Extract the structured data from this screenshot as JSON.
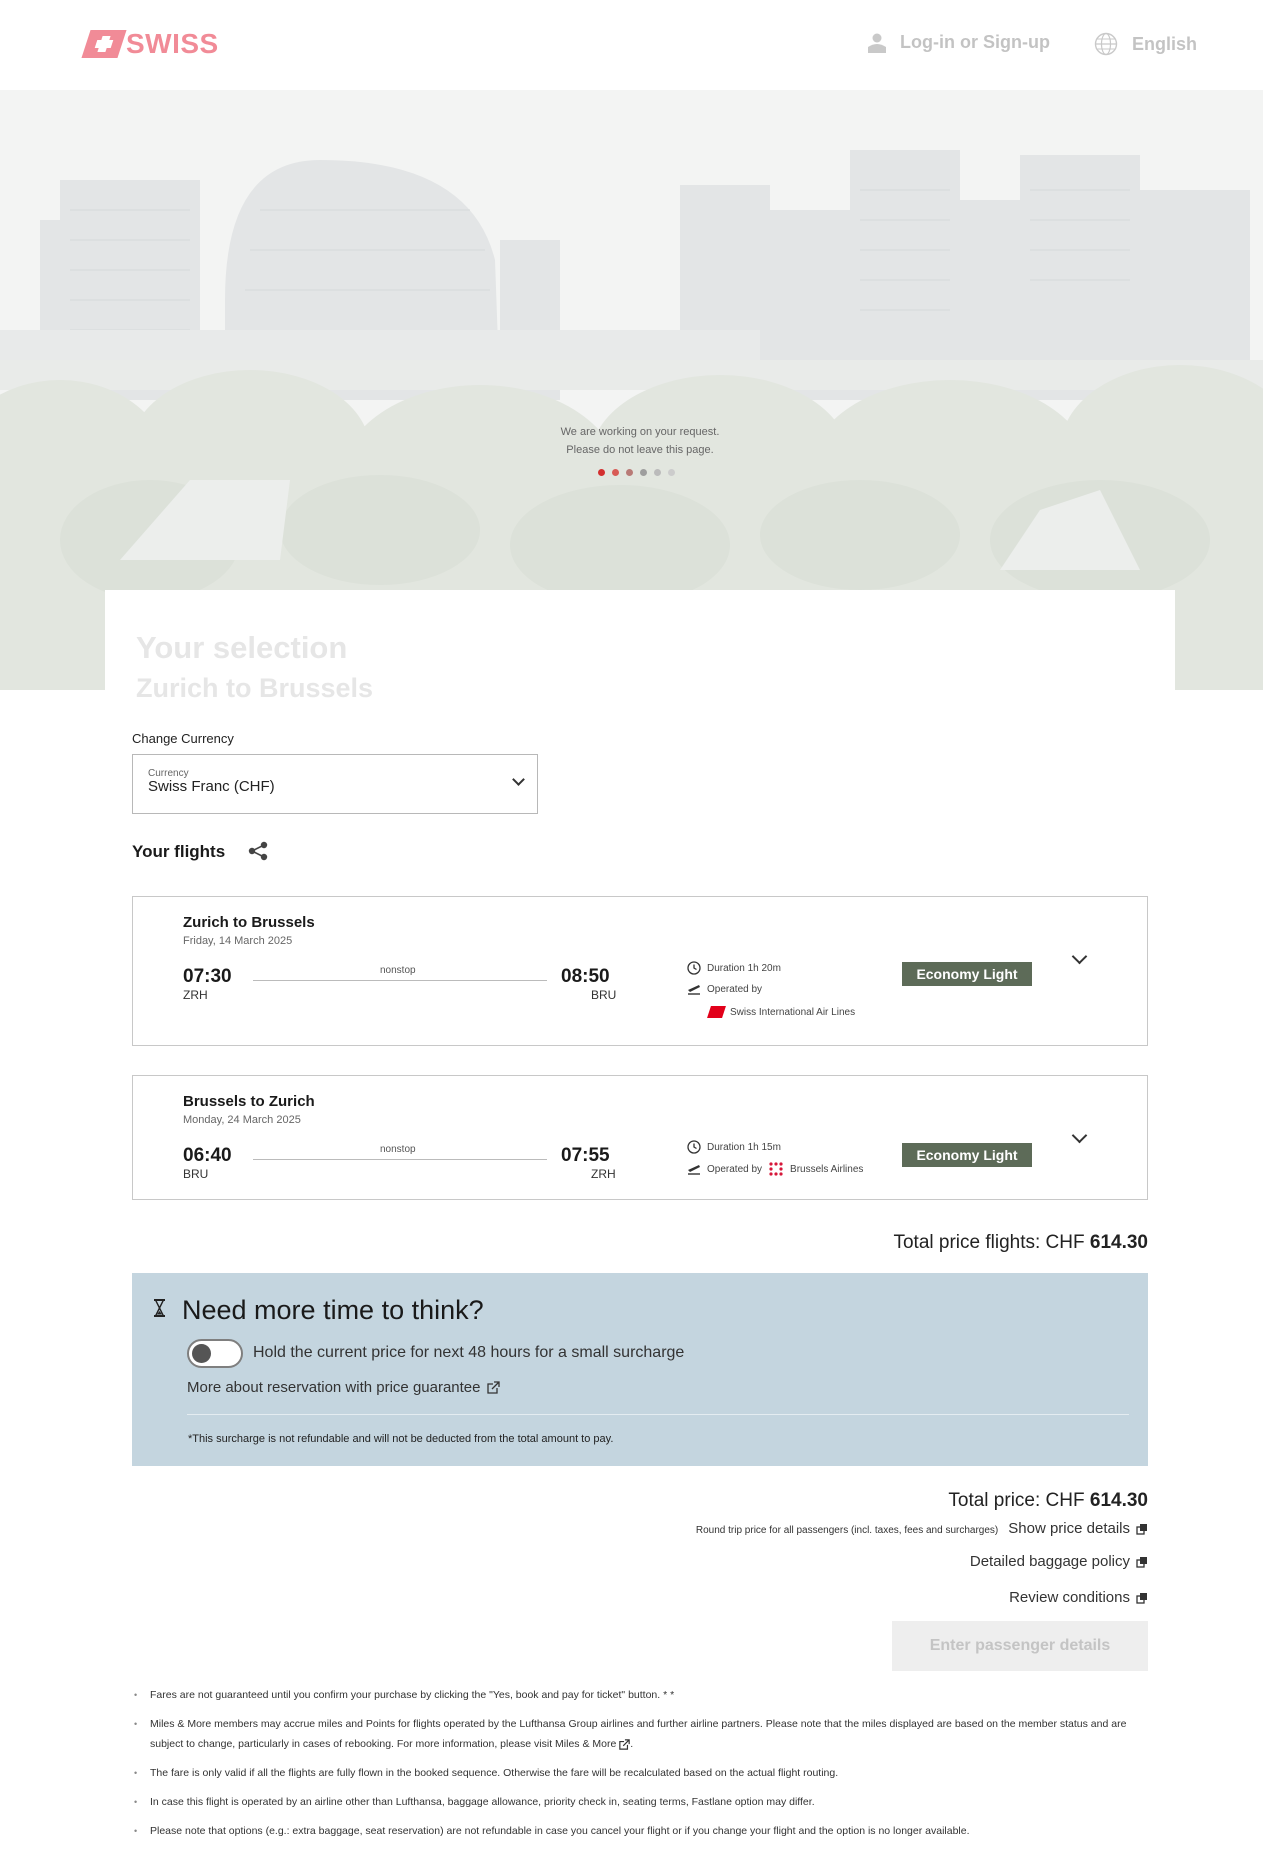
{
  "header": {
    "logo_text": "SWISS",
    "login_label": "Log-in or Sign-up",
    "language_label": "English"
  },
  "loading": {
    "line1": "We are working on your request.",
    "line2": "Please do not leave this page.",
    "active_color": "#d32f2f",
    "inactive_color": "#9e9e9e"
  },
  "selection": {
    "title": "Your selection",
    "subtitle": "Zurich to Brussels"
  },
  "currency": {
    "label": "Change Currency",
    "field_label": "Currency",
    "value": "Swiss Franc (CHF)"
  },
  "flights_title": "Your flights",
  "flights": [
    {
      "route": "Zurich to Brussels",
      "date": "Friday, 14 March 2025",
      "dep_time": "07:30",
      "dep_code": "ZRH",
      "arr_time": "08:50",
      "arr_code": "BRU",
      "stops": "nonstop",
      "duration": "Duration  1h 20m",
      "operated_label": "Operated by",
      "operator": "Swiss International Air Lines",
      "fare": "Economy Light"
    },
    {
      "route": "Brussels to Zurich",
      "date": "Monday, 24 March 2025",
      "dep_time": "06:40",
      "dep_code": "BRU",
      "arr_time": "07:55",
      "arr_code": "ZRH",
      "stops": "nonstop",
      "duration": "Duration  1h 15m",
      "operated_label": "Operated by",
      "operator": "Brussels Airlines",
      "fare": "Economy Light"
    }
  ],
  "total_flights": {
    "label": "Total price flights: CHF",
    "amount": "614.30"
  },
  "hold": {
    "title": "Need more time to think?",
    "toggle_text": "Hold the current price for next 48 hours for a small surcharge",
    "link": "More about reservation with price guarantee",
    "note": "*This surcharge is not refundable and will not be deducted from the total amount to pay.",
    "bg_color": "#c4d5df"
  },
  "total": {
    "label": "Total price: CHF",
    "amount": "614.30",
    "round_trip_note": "Round trip price for all passengers (incl. taxes, fees and surcharges)",
    "show_details": "Show price details",
    "baggage": "Detailed baggage policy",
    "review": "Review conditions",
    "enter_button": "Enter passenger details"
  },
  "footnotes": {
    "f1": "Fares are not guaranteed until you confirm your purchase by clicking the \"Yes, book and pay for ticket\" button. * *",
    "f2": "Miles & More members may accrue miles and Points for flights operated by the Lufthansa Group airlines and further airline partners. Please note that the miles displayed are based on the member status and are subject to change, particularly in cases of rebooking. For more information, please visit",
    "f2_link": "Miles & More",
    "f3": "The fare is only valid if all the flights are fully flown in the booked sequence. Otherwise the fare will be recalculated based on the actual flight routing.",
    "f4": "In case this flight is operated by an airline other than Lufthansa, baggage allowance, priority check in, seating terms, Fastlane option may differ.",
    "f5": "Please note that options (e.g.: extra baggage, seat reservation) are not refundable in case you cancel your flight or if you change your flight and the option is no longer available."
  },
  "colors": {
    "brand_red": "#e2001a",
    "fare_badge": "#5d6b58"
  }
}
